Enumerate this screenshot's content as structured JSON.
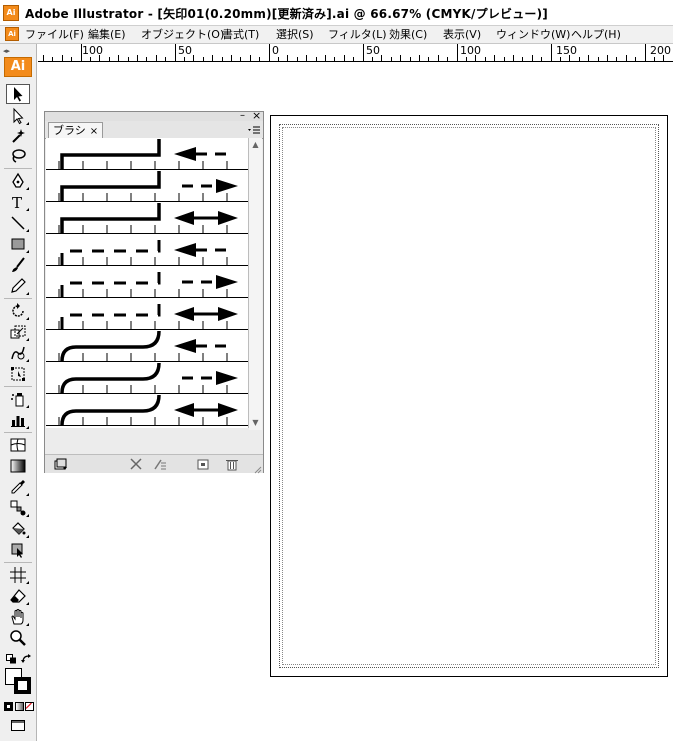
{
  "window": {
    "app_icon": "Ai",
    "title": "Adobe Illustrator - [矢印01(0.20mm)[更新済み].ai @ 66.67% (CMYK/プレビュー)]"
  },
  "menubar": {
    "app_icon": "Ai",
    "items": [
      {
        "label": "ファイル(F)"
      },
      {
        "label": "編集(E)"
      },
      {
        "label": "オブジェクト(O)"
      },
      {
        "label": "書式(T)"
      },
      {
        "label": "選択(S)"
      },
      {
        "label": "フィルタ(L)"
      },
      {
        "label": "効果(C)"
      },
      {
        "label": "表示(V)"
      },
      {
        "label": "ウィンドウ(W)"
      },
      {
        "label": "ヘルプ(H)"
      }
    ]
  },
  "ruler": {
    "labels": [
      "100",
      "50",
      "0",
      "50",
      "100",
      "150",
      "200"
    ]
  },
  "toolbox": {
    "badge": "Ai",
    "tools": [
      {
        "name": "selection-tool-icon",
        "active": true
      },
      {
        "name": "direct-selection-tool-icon"
      },
      {
        "name": "magic-wand-tool-icon"
      },
      {
        "name": "lasso-tool-icon"
      },
      {
        "name": "pen-tool-icon"
      },
      {
        "name": "type-tool-icon"
      },
      {
        "name": "line-segment-tool-icon"
      },
      {
        "name": "rectangle-tool-icon"
      },
      {
        "name": "paintbrush-tool-icon"
      },
      {
        "name": "pencil-tool-icon"
      },
      {
        "name": "rotate-tool-icon"
      },
      {
        "name": "scale-tool-icon"
      },
      {
        "name": "warp-tool-icon"
      },
      {
        "name": "free-transform-tool-icon"
      },
      {
        "name": "symbol-sprayer-tool-icon"
      },
      {
        "name": "column-graph-tool-icon"
      },
      {
        "name": "mesh-tool-icon"
      },
      {
        "name": "gradient-tool-icon"
      },
      {
        "name": "eyedropper-tool-icon"
      },
      {
        "name": "blend-tool-icon"
      },
      {
        "name": "live-paint-bucket-tool-icon"
      },
      {
        "name": "live-paint-selection-tool-icon"
      },
      {
        "name": "slice-tool-icon"
      },
      {
        "name": "eraser-tool-icon"
      },
      {
        "name": "hand-tool-icon"
      },
      {
        "name": "zoom-tool-icon"
      }
    ],
    "colors": {
      "fill": "#ffffff",
      "stroke": "#000000",
      "none_slash": "#e0202a",
      "accent": "#f38b1b"
    }
  },
  "brush_panel": {
    "tab_label": "ブラシ",
    "tab_close": "×",
    "minimize": "–",
    "close": "×",
    "menu_icon": "panel-menu-icon",
    "brushes": [
      {
        "corner": "square",
        "dashed": false,
        "arrow": "left"
      },
      {
        "corner": "square",
        "dashed": false,
        "arrow": "right"
      },
      {
        "corner": "square",
        "dashed": false,
        "arrow": "both"
      },
      {
        "corner": "square",
        "dashed": true,
        "arrow": "left"
      },
      {
        "corner": "square",
        "dashed": true,
        "arrow": "right"
      },
      {
        "corner": "square",
        "dashed": true,
        "arrow": "both"
      },
      {
        "corner": "round",
        "dashed": false,
        "arrow": "left"
      },
      {
        "corner": "round",
        "dashed": false,
        "arrow": "right"
      },
      {
        "corner": "round",
        "dashed": false,
        "arrow": "both"
      }
    ],
    "bottom_buttons": [
      "brush-libraries-menu-icon",
      "remove-brush-stroke-icon",
      "brush-options-icon",
      "new-brush-icon",
      "delete-brush-icon"
    ]
  }
}
